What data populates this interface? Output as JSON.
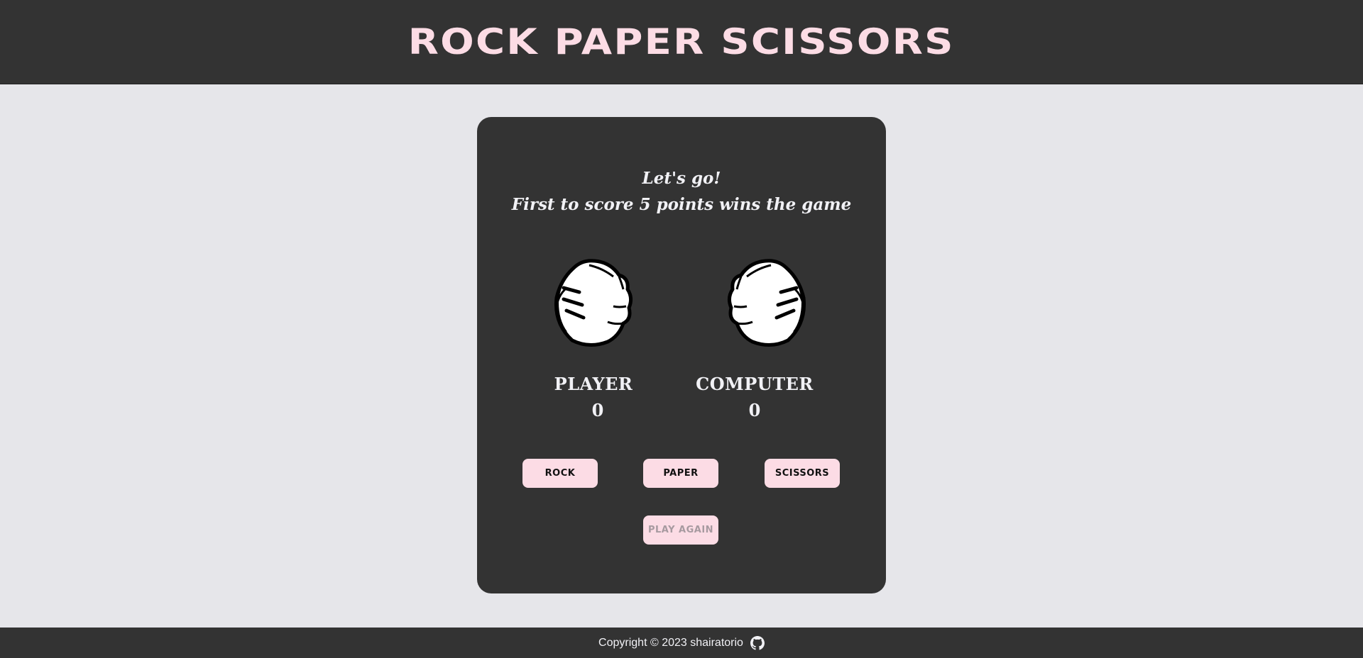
{
  "header": {
    "title": "ROCK PAPER SCISSORS"
  },
  "game": {
    "message_line1": "Let's go!",
    "message_line2": "First to score 5 points wins the game",
    "player_hand": "rock-fist-icon",
    "computer_hand": "rock-fist-icon",
    "player_label": "PLAYER",
    "player_score": "0",
    "computer_label": "COMPUTER",
    "computer_score": "0"
  },
  "buttons": {
    "rock": "ROCK",
    "paper": "PAPER",
    "scissors": "SCISSORS",
    "play_again": "PLAY AGAIN"
  },
  "footer": {
    "copyright": "Copyright © 2023 shairatorio",
    "icon": "github-icon"
  },
  "colors": {
    "dark": "#333333",
    "accent_pink": "#fcdce5",
    "background": "#e6e6ea"
  }
}
